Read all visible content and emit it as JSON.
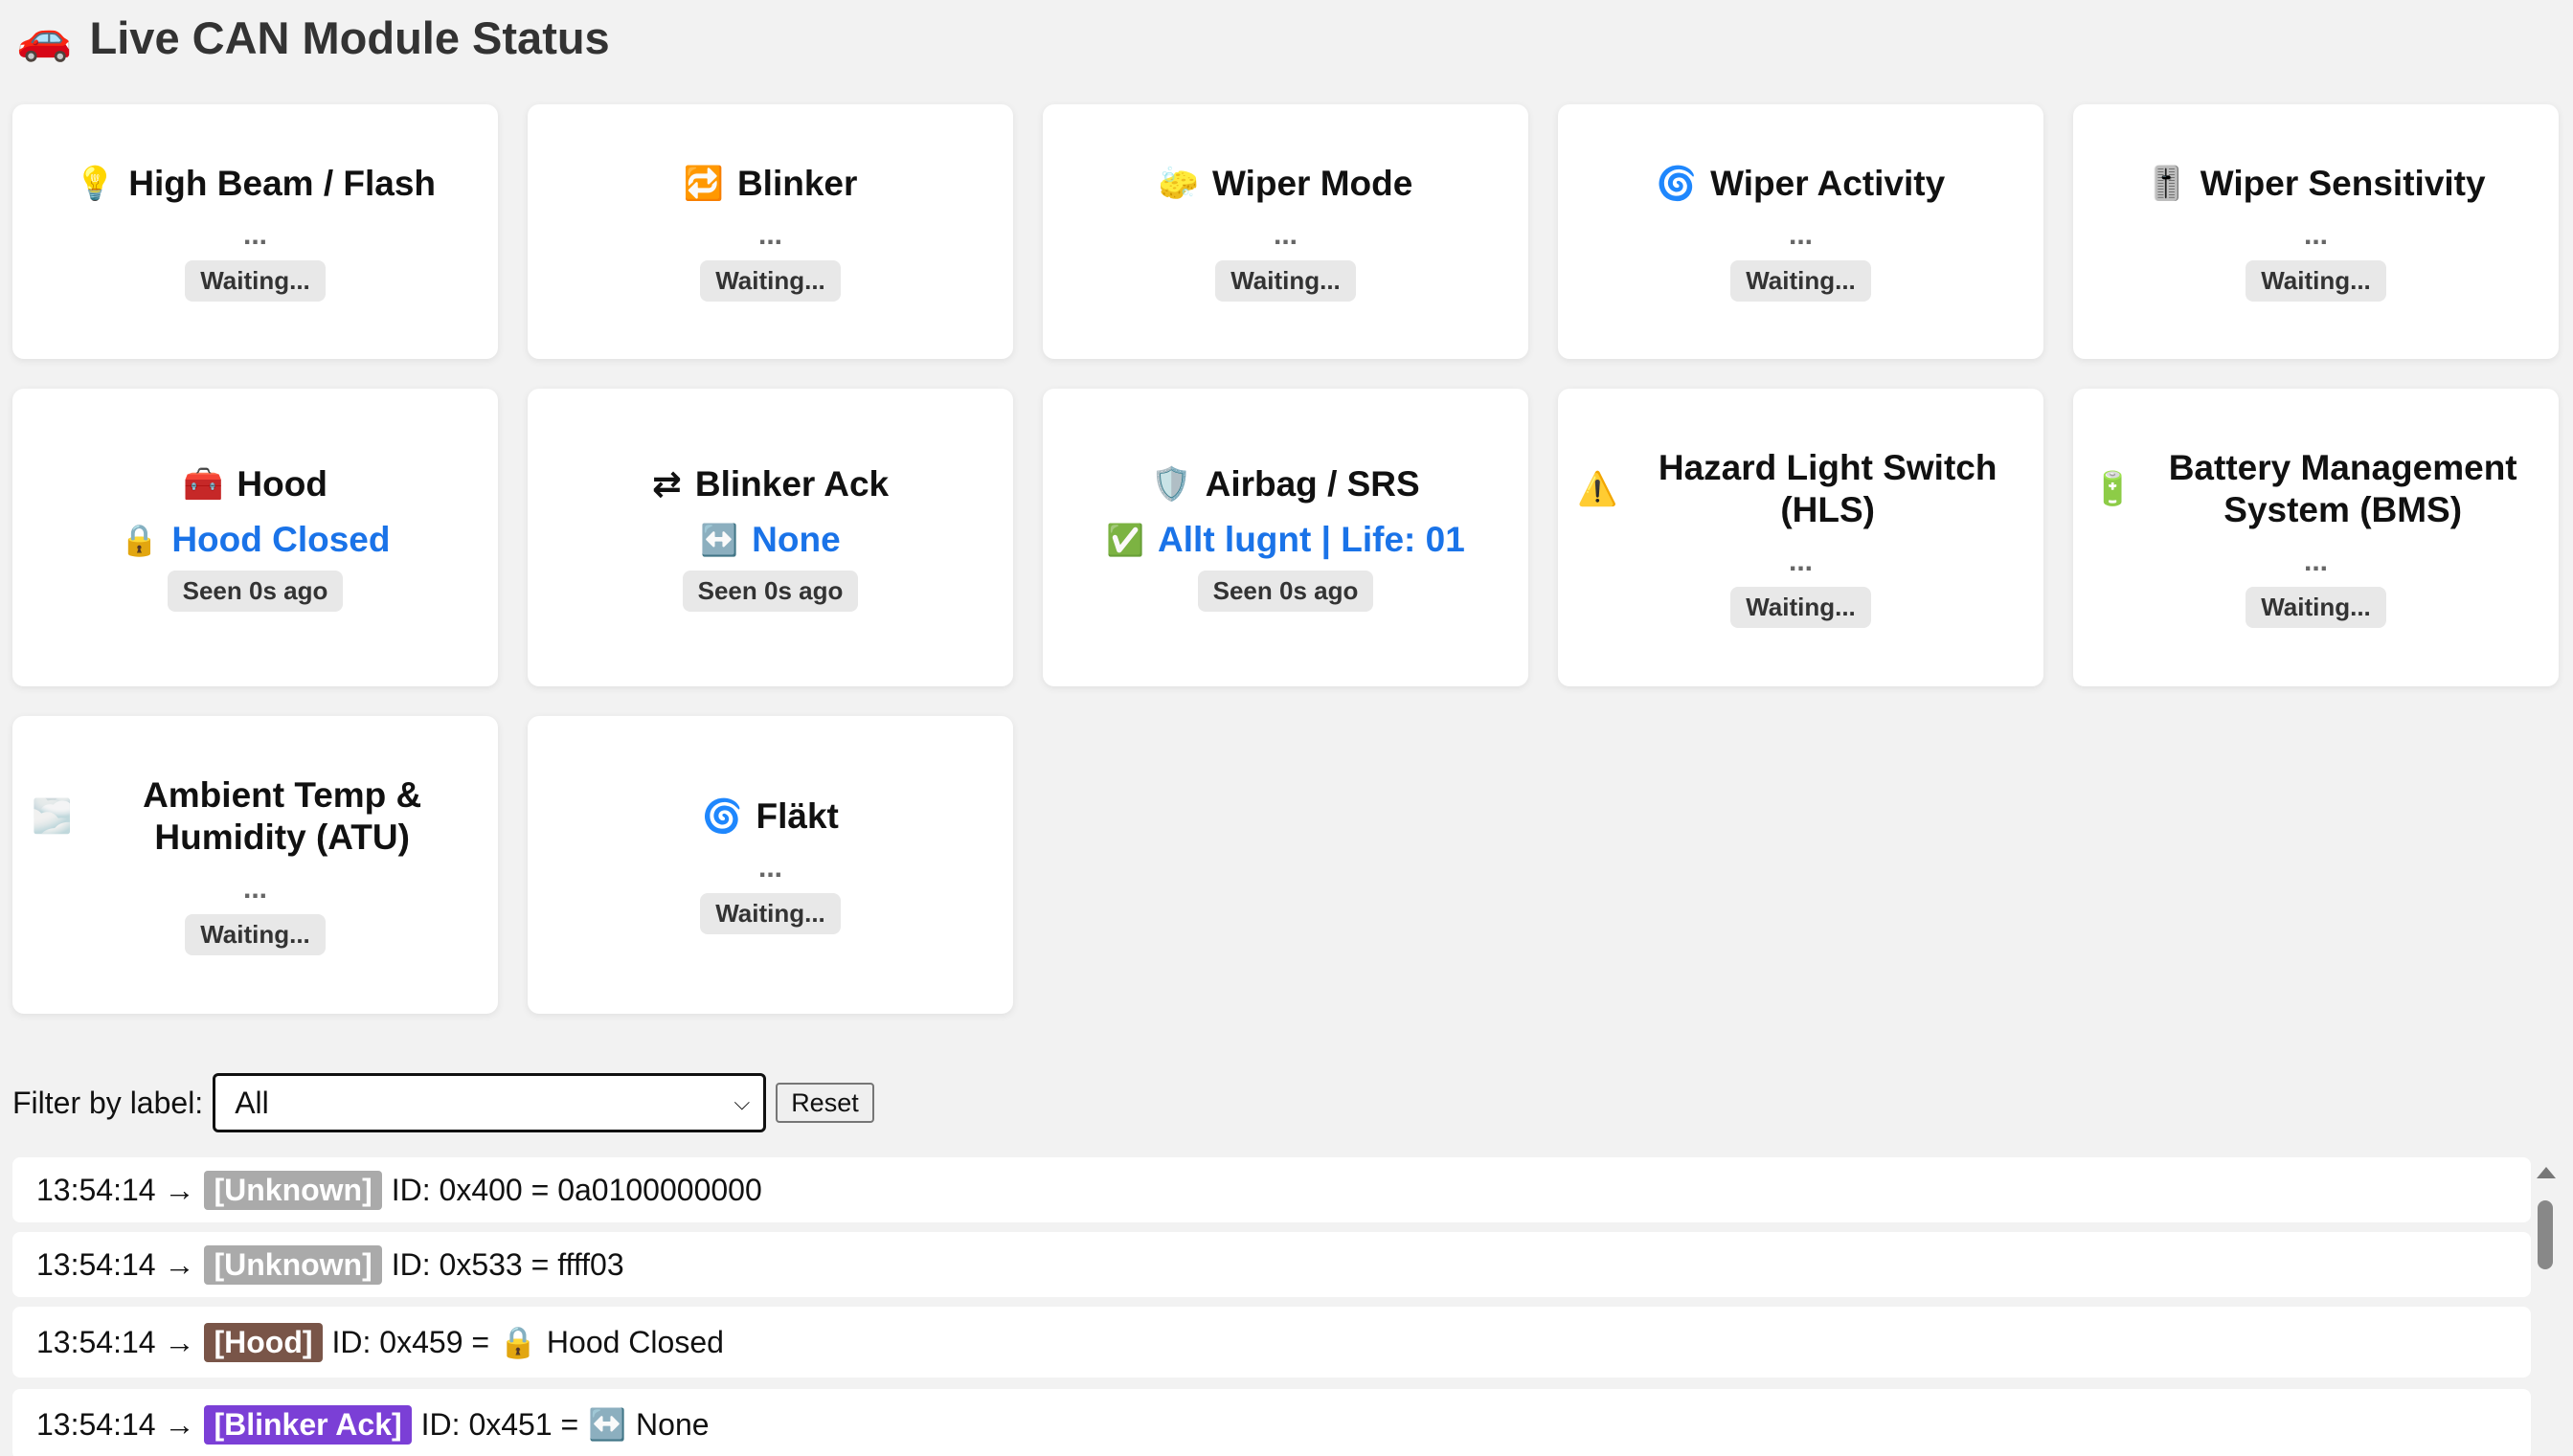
{
  "header": {
    "icon": "🚗",
    "title": "Live CAN Module Status"
  },
  "cards": [
    {
      "icon": "💡",
      "title": "High Beam / Flash",
      "value": "...",
      "status": "Waiting..."
    },
    {
      "icon": "🔁",
      "title": "Blinker",
      "value": "...",
      "status": "Waiting..."
    },
    {
      "icon": "🧽",
      "title": "Wiper Mode",
      "value": "...",
      "status": "Waiting..."
    },
    {
      "icon": "🌀",
      "title": "Wiper Activity",
      "value": "...",
      "status": "Waiting..."
    },
    {
      "icon": "🎚️",
      "title": "Wiper Sensitivity",
      "value": "...",
      "status": "Waiting..."
    },
    {
      "icon": "🧰",
      "title": "Hood",
      "value_icon": "🔒",
      "value": "Hood Closed",
      "status": "Seen 0s ago"
    },
    {
      "icon": "⇄",
      "title": "Blinker Ack",
      "value_icon": "↔️",
      "value": "None",
      "status": "Seen 0s ago"
    },
    {
      "icon": "🛡️",
      "title": "Airbag / SRS",
      "value_icon": "✅",
      "value": "Allt lugnt | Life: 01",
      "status": "Seen 0s ago"
    },
    {
      "icon": "⚠️",
      "title": "Hazard Light Switch (HLS)",
      "value": "...",
      "status": "Waiting..."
    },
    {
      "icon": "🔋",
      "title": "Battery Management System (BMS)",
      "value": "...",
      "status": "Waiting..."
    },
    {
      "icon": "🌫️",
      "title": "Ambient Temp & Humidity (ATU)",
      "value": "...",
      "status": "Waiting..."
    },
    {
      "icon": "🌀",
      "title": "Fläkt",
      "value": "...",
      "status": "Waiting..."
    }
  ],
  "filter": {
    "label": "Filter by label:",
    "selected": "All",
    "reset_label": "Reset"
  },
  "log": [
    {
      "time": "13:54:14 →",
      "tag": "[Unknown]",
      "text": "ID: 0x400 = 0a0100000000",
      "icon": ""
    },
    {
      "time": "13:54:14 →",
      "tag": "[Unknown]",
      "text": "ID: 0x533 = ffff03",
      "icon": ""
    },
    {
      "time": "13:54:14 →",
      "tag": "[Hood]",
      "text": "ID: 0x459 =",
      "icon": "🔒",
      "value": "Hood Closed"
    },
    {
      "time": "13:54:14 →",
      "tag": "[Blinker Ack]",
      "text": "ID: 0x451 =",
      "icon": "↔️",
      "value": "None"
    }
  ],
  "colors": {
    "active_value": "#1a73e8",
    "tag_unknown": "#aaaaaa",
    "tag_hood": "#795548",
    "tag_blinker_ack": "#7b3fd6"
  }
}
